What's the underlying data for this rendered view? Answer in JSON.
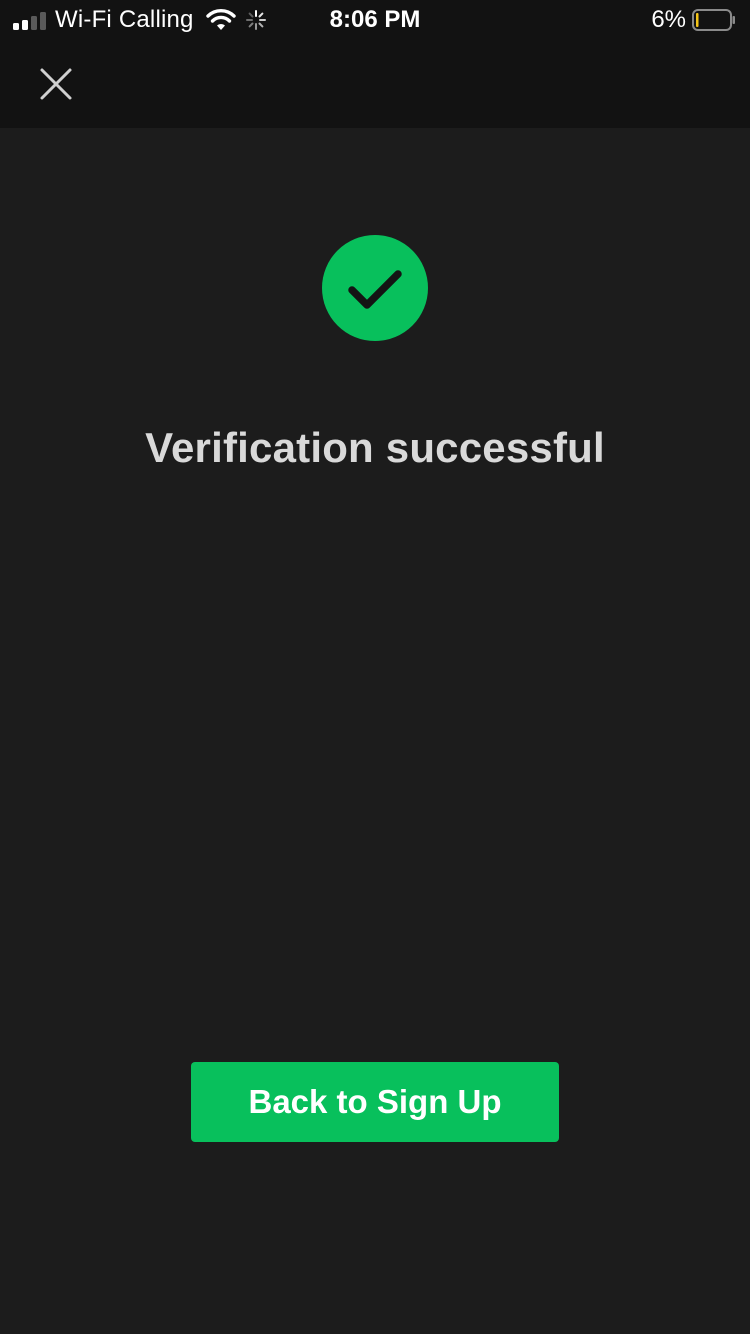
{
  "status_bar": {
    "carrier": "Wi-Fi Calling",
    "time": "8:06 PM",
    "battery_percent": "6%",
    "signal_bars_filled": 2,
    "signal_bars_total": 4,
    "icons": [
      "signal-icon",
      "wifi-icon",
      "activity-spinner-icon",
      "battery-icon"
    ]
  },
  "nav": {
    "close_icon": "close-icon"
  },
  "content": {
    "status_icon": "checkmark-icon",
    "headline": "Verification successful"
  },
  "actions": {
    "primary_label": "Back to Sign Up"
  },
  "colors": {
    "accent": "#08c05c",
    "background": "#1c1c1c",
    "header_background": "#121212",
    "headline_text": "#d9d9d9",
    "battery_low": "#f5c518"
  }
}
